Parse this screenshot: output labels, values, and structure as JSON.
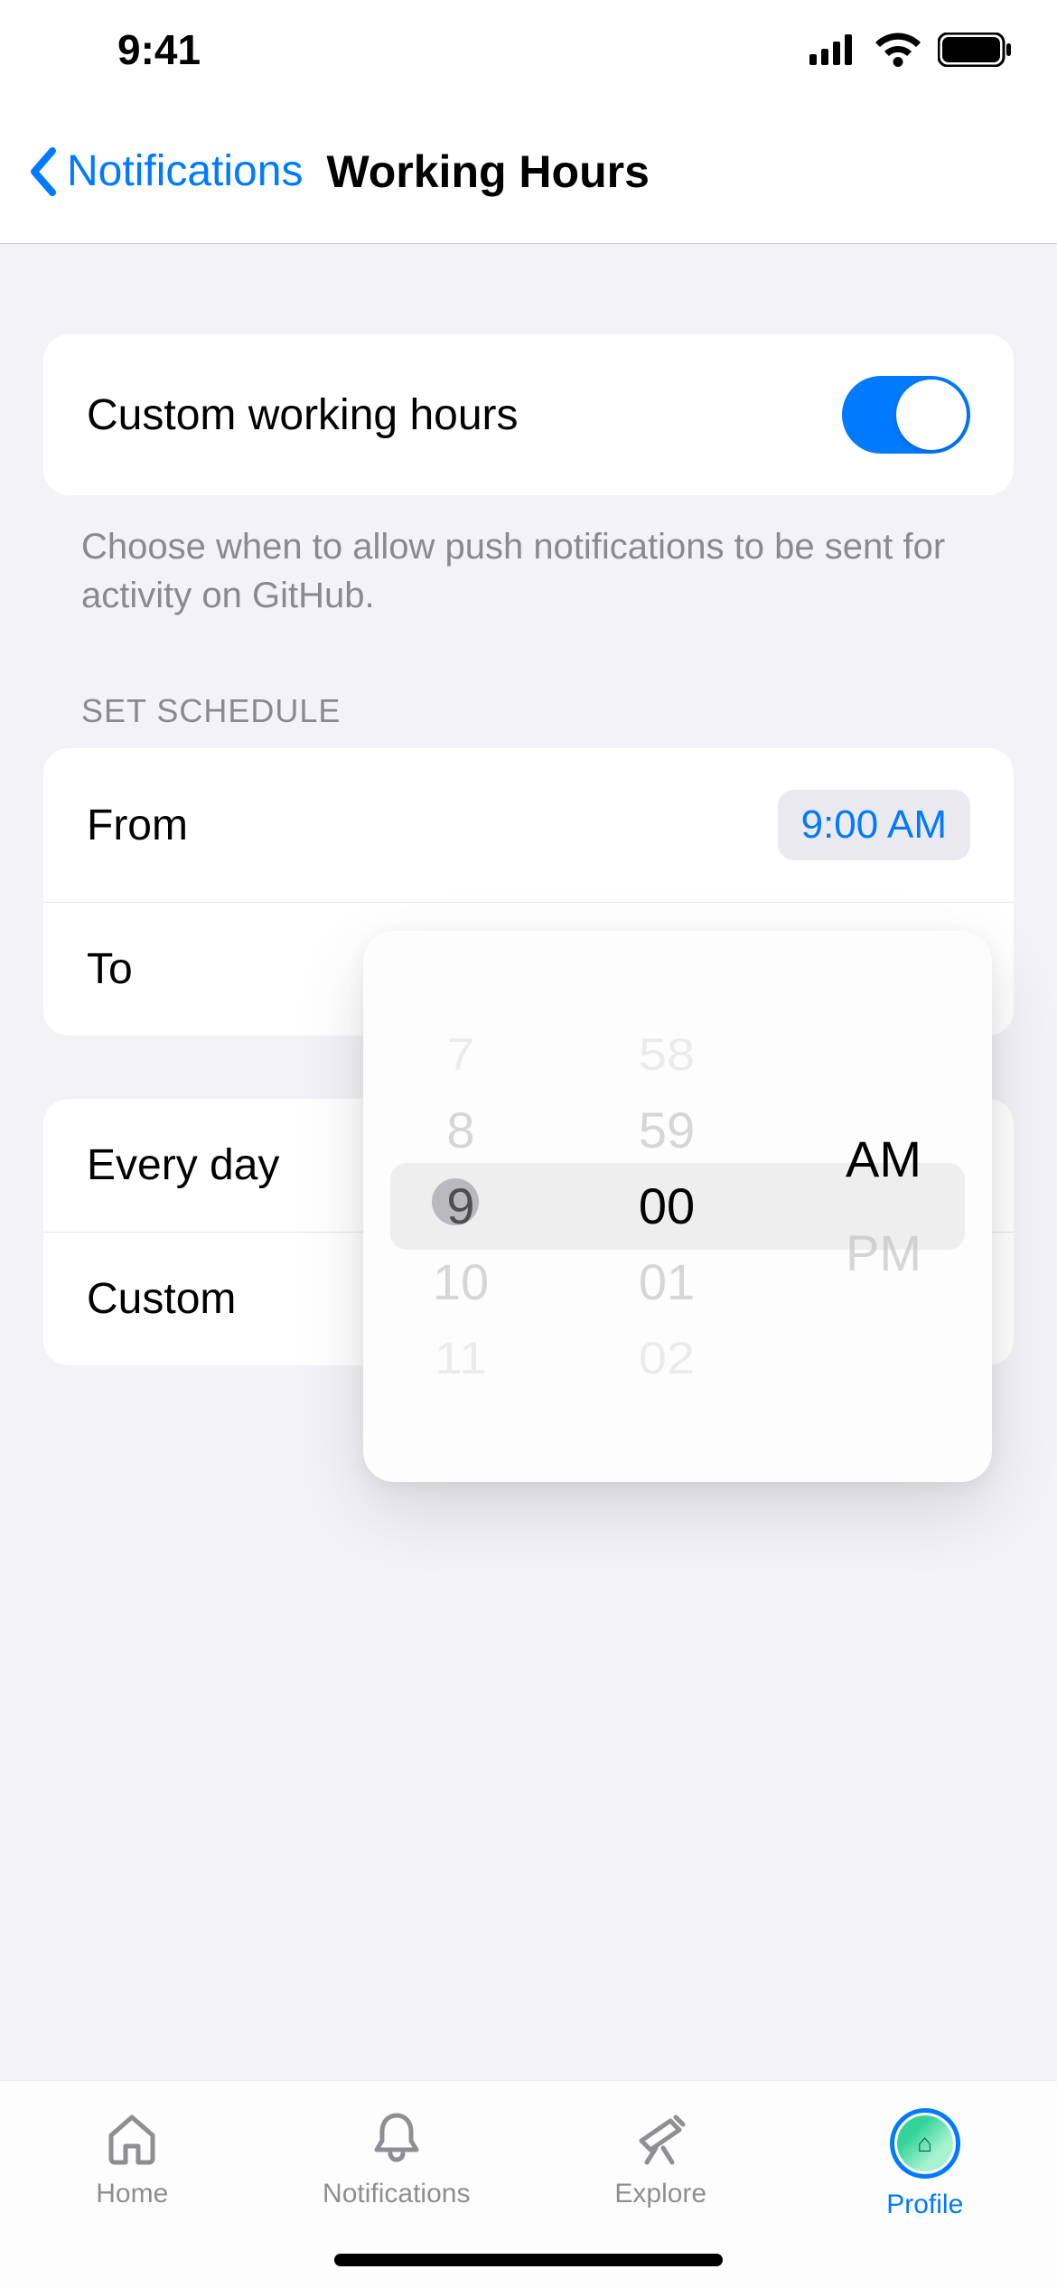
{
  "status": {
    "time": "9:41"
  },
  "nav": {
    "back_label": "Notifications",
    "title": "Working Hours"
  },
  "toggle_row": {
    "label": "Custom working hours",
    "on": true
  },
  "note": "Choose when to allow push notifications to be sent for activity on GitHub.",
  "schedule": {
    "header": "SET SCHEDULE",
    "from_label": "From",
    "from_value": "9:00 AM",
    "to_label": "To"
  },
  "days_group": {
    "every_label": "Every day",
    "custom_label": "Custom"
  },
  "picker": {
    "hours": [
      "7",
      "8",
      "9",
      "10",
      "11"
    ],
    "minutes": [
      "58",
      "59",
      "00",
      "01",
      "02"
    ],
    "ampm": [
      "AM",
      "PM"
    ]
  },
  "tabs": {
    "home": "Home",
    "notifications": "Notifications",
    "explore": "Explore",
    "profile": "Profile"
  }
}
